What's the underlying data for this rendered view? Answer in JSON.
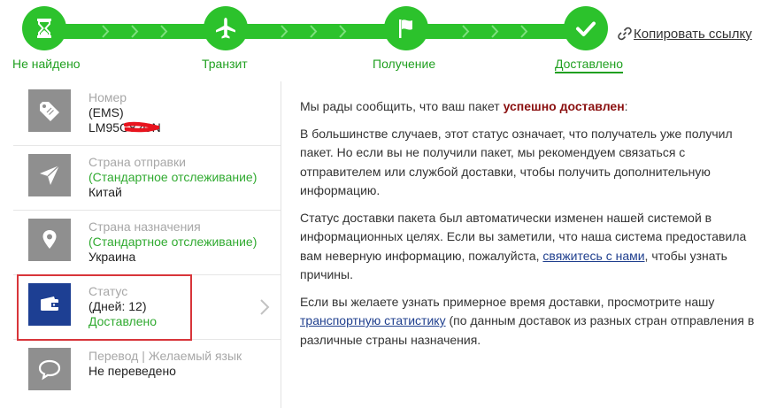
{
  "progress": {
    "steps": [
      {
        "label": "Не найдено",
        "icon": "hourglass-icon"
      },
      {
        "label": "Транзит",
        "icon": "airplane-icon"
      },
      {
        "label": "Получение",
        "icon": "flag-icon"
      },
      {
        "label": "Доставлено",
        "icon": "checkmark-icon",
        "active": true
      }
    ],
    "copy_link": "Копировать ссылку",
    "color": "#2cc22c"
  },
  "details": {
    "number": {
      "label": "Номер",
      "carrier": "(EMS)",
      "value": "LM95G82CN"
    },
    "origin": {
      "label": "Страна отправки",
      "tracking": "(Стандартное отслеживание)",
      "value": "Китай"
    },
    "destination": {
      "label": "Страна назначения",
      "tracking": "(Стандартное отслеживание)",
      "value": "Украина"
    },
    "status": {
      "label": "Статус",
      "days": "(Дней: 12)",
      "value": "Доставлено",
      "accent": "#1d3f93"
    },
    "translation": {
      "label": "Перевод | Желаемый язык",
      "value": "Не переведено"
    }
  },
  "message": {
    "p1_pre": "Мы рады сообщить, что ваш пакет ",
    "p1_bold": "успешно доставлен",
    "p1_post": ":",
    "p2": "В большинстве случаев, этот статус означает, что получатель уже получил пакет. Но если вы не получили пакет, мы рекомендуем связаться с отправителем или службой доставки, чтобы получить дополнительную информацию.",
    "p3_pre": "Статус доставки пакета был автоматически изменен нашей системой в информационных целях. Если вы заметили, что наша система предоставила вам неверную информацию, пожалуйста, ",
    "p3_link": "свяжитесь с нами",
    "p3_post": ", чтобы узнать причины.",
    "p4_pre": "Если вы желаете узнать примерное время доставки, просмотрите нашу ",
    "p4_link": "транспортную статистику",
    "p4_post": " (по данным доставок из разных стран отправления в различные страны назначения."
  }
}
